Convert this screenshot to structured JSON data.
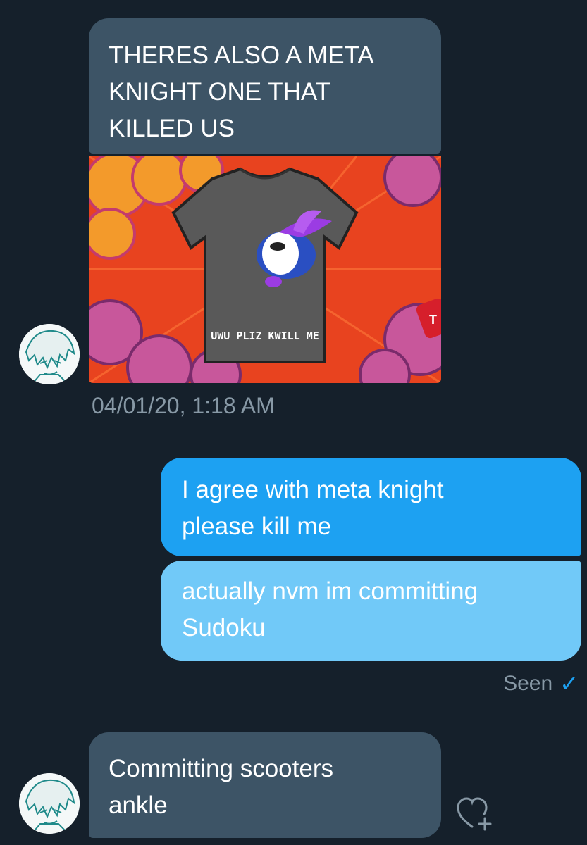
{
  "conversation": {
    "messages": [
      {
        "direction": "incoming",
        "text": "THERES ALSO A META KNIGHT ONE THAT KILLED US",
        "lines": [
          "THERES ALSO A META",
          "KNIGHT ONE THAT",
          "KILLED US"
        ]
      },
      {
        "direction": "incoming",
        "type": "image",
        "image_caption": "UWU PLIZ KWILL ME",
        "image_badge": "T"
      },
      {
        "direction": "outgoing",
        "text": "I agree with meta knight please kill me",
        "lines": [
          "I agree with meta knight",
          "please kill me"
        ]
      },
      {
        "direction": "outgoing",
        "text": "actually nvm im committing Sudoku",
        "lines": [
          "actually nvm im committing",
          "Sudoku"
        ]
      },
      {
        "direction": "incoming",
        "text": "Committing scooters ankle",
        "lines": [
          "Committing scooters",
          "ankle"
        ]
      }
    ],
    "timestamp": "04/01/20, 1:18 AM",
    "seen_label": "Seen",
    "seen_icon": "check-icon",
    "react_icon": "heart-plus-icon"
  },
  "colors": {
    "background": "#15202b",
    "incoming_bubble": "#3d5466",
    "outgoing_bubble": "#1da1f2",
    "outgoing_bubble_pending": "#71c9f8",
    "muted_text": "#8899a6"
  }
}
